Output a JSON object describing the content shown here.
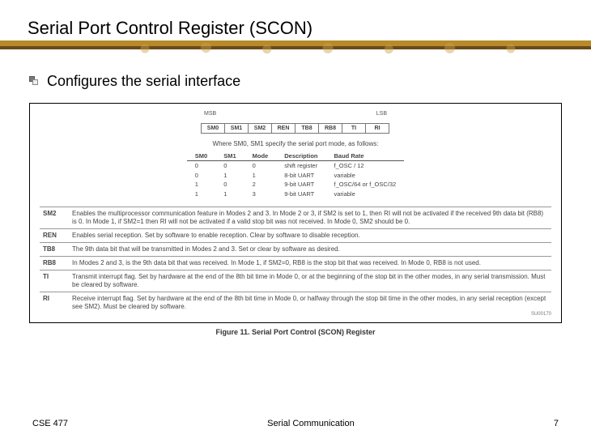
{
  "title": "Serial Port Control Register (SCON)",
  "bullet": "Configures the serial interface",
  "register": {
    "msb": "MSB",
    "lsb": "LSB",
    "bits": [
      "SM0",
      "SM1",
      "SM2",
      "REN",
      "TB8",
      "RB8",
      "TI",
      "RI"
    ],
    "explain": "Where SM0, SM1 specify the serial port mode, as follows:"
  },
  "mode_table": {
    "headers": [
      "SM0",
      "SM1",
      "Mode",
      "Description",
      "Baud Rate"
    ],
    "rows": [
      [
        "0",
        "0",
        "0",
        "shift register",
        "f_OSC / 12"
      ],
      [
        "0",
        "1",
        "1",
        "8-bit UART",
        "variable"
      ],
      [
        "1",
        "0",
        "2",
        "9-bit UART",
        "f_OSC/64 or f_OSC/32"
      ],
      [
        "1",
        "1",
        "3",
        "9-bit UART",
        "variable"
      ]
    ]
  },
  "defs": [
    {
      "k": "SM2",
      "v": "Enables the multiprocessor communication feature in Modes 2 and 3. In Mode 2 or 3, if SM2 is set to 1, then RI will not be activated if the received 9th data bit (RB8) is 0. In Mode 1, if SM2=1 then RI will not be activated if a valid stop bit was not received. In Mode 0, SM2 should be 0."
    },
    {
      "k": "REN",
      "v": "Enables serial reception. Set by software to enable reception. Clear by software to disable reception."
    },
    {
      "k": "TB8",
      "v": "The 9th data bit that will be transmitted in Modes 2 and 3. Set or clear by software as desired."
    },
    {
      "k": "RB8",
      "v": "In Modes 2 and 3, is the 9th data bit that was received. In Mode 1, if SM2=0, RB8 is the stop bit that was received. In Mode 0, RB8 is not used."
    },
    {
      "k": "TI",
      "v": "Transmit interrupt flag. Set by hardware at the end of the 8th bit time in Mode 0, or at the beginning of the stop bit in the other modes, in any serial transmission. Must be cleared by software."
    },
    {
      "k": "RI",
      "v": "Receive interrupt flag. Set by hardware at the end of the 8th bit time in Mode 0, or halfway through the stop bit time in the other modes, in any serial reception (except see SM2). Must be cleared by software."
    }
  ],
  "fig_id": "SU00170",
  "fig_caption": "Figure 11. Serial Port Control (SCON) Register",
  "footer": {
    "course": "CSE 477",
    "topic": "Serial Communication",
    "page": "7"
  }
}
